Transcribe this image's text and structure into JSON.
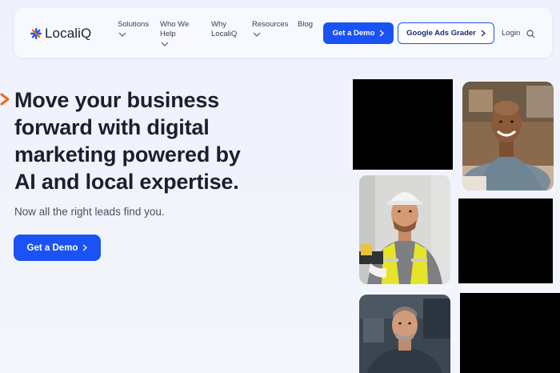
{
  "brand": {
    "name": "LocaliQ",
    "logo_color": "#1a52f5",
    "accent_color": "#f26a1b"
  },
  "nav": {
    "items": [
      {
        "label_line1": "Solutions",
        "label_line2": "",
        "has_dropdown": true
      },
      {
        "label_line1": "Who We",
        "label_line2": "Help",
        "has_dropdown": true
      },
      {
        "label_line1": "Why",
        "label_line2": "LocaliQ",
        "has_dropdown": false
      },
      {
        "label_line1": "Resources",
        "label_line2": "",
        "has_dropdown": true
      },
      {
        "label_line1": "Blog",
        "label_line2": "",
        "has_dropdown": false
      }
    ],
    "demo_button": "Get a Demo",
    "grader_button": "Google Ads Grader",
    "login": "Login",
    "search_icon": "search-icon"
  },
  "hero": {
    "title_bold_1": "Move your business",
    "title_bold_2": "forward",
    "title_rest_2": " with digital",
    "title_line_3": "marketing powered by",
    "title_line_4": "AI and local expertise.",
    "subtitle": "Now all the right leads find you.",
    "cta": "Get a Demo"
  },
  "gallery": {
    "photos": [
      {
        "subject": "smiling man at desk"
      },
      {
        "subject": "worker in hard hat and safety vest"
      },
      {
        "subject": "mechanic in workshop"
      }
    ]
  }
}
